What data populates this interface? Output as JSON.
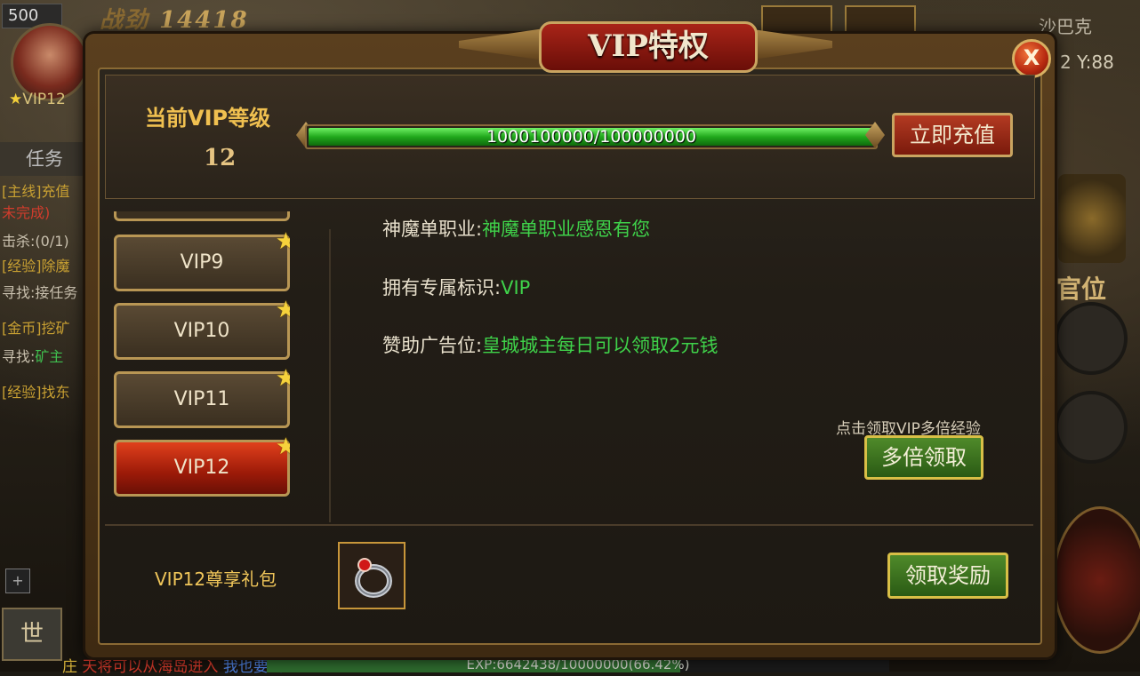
{
  "hud": {
    "level": "500",
    "power_label": "战劲",
    "power_value": "14418",
    "vip_badge": "VIP12",
    "task_tab": "任务",
    "quests": [
      {
        "tag": "[主线]",
        "text": "充值"
      },
      {
        "tag": "",
        "text": "未完成)"
      },
      {
        "tag": "",
        "text": "击杀:(0/1)"
      },
      {
        "tag": "[经验]",
        "text": "除魔"
      },
      {
        "tag": "",
        "text": "寻找:接任务"
      },
      {
        "tag": "[金币]",
        "text": "挖矿"
      },
      {
        "tag": "寻找:",
        "text": "矿主"
      },
      {
        "tag": "[经验]",
        "text": "找东"
      }
    ],
    "plus_label": "+",
    "mic_label": "世",
    "chat": {
      "channel": "庄",
      "message": "天将可以从海岛进入",
      "link": "我也要去"
    },
    "exp_text": "EXP:6642438/10000000(66.42%)",
    "exp_ratio": 0.6642,
    "right_name": "沙巴克",
    "right_coord": "2 Y:88",
    "right_rank": "官位"
  },
  "dialog": {
    "title": "VIP特权",
    "close_label": "X",
    "current_label": "当前VIP等级",
    "current_level": "12",
    "progress_text": "1000100000/100000000",
    "progress_ratio": 1.0,
    "recharge_label": "立即充值",
    "vip_levels": [
      {
        "label": "VIP9",
        "active": false
      },
      {
        "label": "VIP10",
        "active": false
      },
      {
        "label": "VIP11",
        "active": false
      },
      {
        "label": "VIP12",
        "active": true
      }
    ],
    "perks": [
      {
        "key": "神魔单职业:",
        "value": "神魔单职业感恩有您"
      },
      {
        "key": "拥有专属标识:",
        "value": "VIP"
      },
      {
        "key": "赞助广告位:",
        "value": "皇城城主每日可以领取2元钱"
      }
    ],
    "multi_hint": "点击领取VIP多倍经验",
    "multi_button": "多倍领取",
    "gift_label": "VIP12尊享礼包",
    "gift_icon": "ring-icon",
    "claim_button": "领取奖励",
    "colors": {
      "accent_gold": "#c9a460",
      "progress_green": "#21a81c",
      "active_red": "#c02a10",
      "perk_value": "#3fd24a"
    }
  }
}
